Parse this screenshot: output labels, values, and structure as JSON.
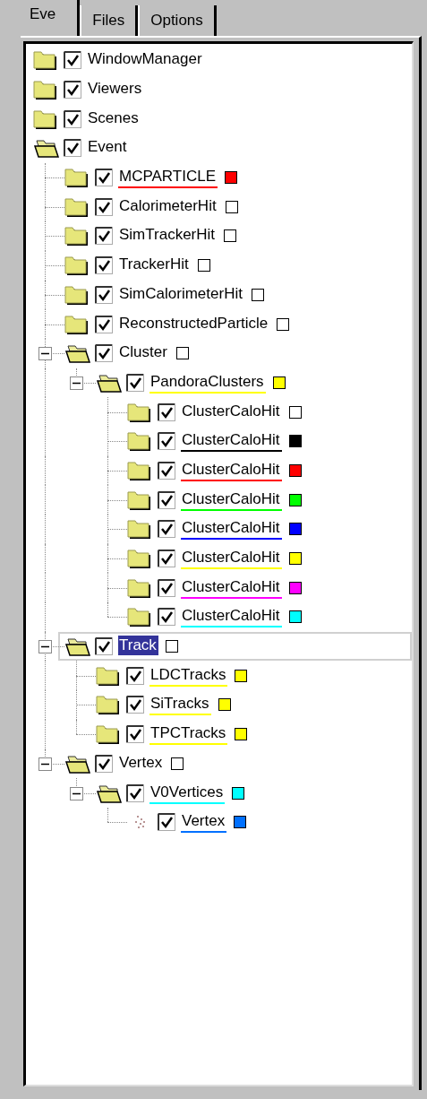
{
  "tabs": [
    {
      "label": "Eve",
      "selected": true
    },
    {
      "label": "Files",
      "selected": false
    },
    {
      "label": "Options",
      "selected": false
    }
  ],
  "tree": [
    {
      "label": "WindowManager",
      "kind": "folder",
      "checked": true,
      "selected": false
    },
    {
      "label": "Viewers",
      "kind": "folder",
      "checked": true,
      "selected": false
    },
    {
      "label": "Scenes",
      "kind": "folder",
      "checked": true,
      "selected": false
    },
    {
      "label": "Event",
      "kind": "folder",
      "checked": true,
      "selected": false,
      "expanded": true,
      "children": [
        {
          "label": "MCPARTICLE",
          "kind": "folder",
          "checked": true,
          "selected": false,
          "color": "#ff0000"
        },
        {
          "label": "CalorimeterHit",
          "kind": "folder",
          "checked": true,
          "selected": false,
          "color": "#ffffff"
        },
        {
          "label": "SimTrackerHit",
          "kind": "folder",
          "checked": true,
          "selected": false,
          "color": "#ffffff"
        },
        {
          "label": "TrackerHit",
          "kind": "folder",
          "checked": true,
          "selected": false,
          "color": "#ffffff"
        },
        {
          "label": "SimCalorimeterHit",
          "kind": "folder",
          "checked": true,
          "selected": false,
          "color": "#ffffff"
        },
        {
          "label": "ReconstructedParticle",
          "kind": "folder",
          "checked": true,
          "selected": false,
          "color": "#ffffff"
        },
        {
          "label": "Cluster",
          "kind": "folder",
          "checked": true,
          "selected": false,
          "color": "#ffffff",
          "expanded": true,
          "children": [
            {
              "label": "PandoraClusters",
              "kind": "folder",
              "checked": true,
              "selected": false,
              "color": "#ffff00",
              "expanded": true,
              "children": [
                {
                  "label": "ClusterCaloHit",
                  "kind": "folder",
                  "checked": true,
                  "selected": false,
                  "color": "#ffffff"
                },
                {
                  "label": "ClusterCaloHit",
                  "kind": "folder",
                  "checked": true,
                  "selected": false,
                  "color": "#000000"
                },
                {
                  "label": "ClusterCaloHit",
                  "kind": "folder",
                  "checked": true,
                  "selected": false,
                  "color": "#ff0000"
                },
                {
                  "label": "ClusterCaloHit",
                  "kind": "folder",
                  "checked": true,
                  "selected": false,
                  "color": "#00ff00"
                },
                {
                  "label": "ClusterCaloHit",
                  "kind": "folder",
                  "checked": true,
                  "selected": false,
                  "color": "#0000ff"
                },
                {
                  "label": "ClusterCaloHit",
                  "kind": "folder",
                  "checked": true,
                  "selected": false,
                  "color": "#ffff00"
                },
                {
                  "label": "ClusterCaloHit",
                  "kind": "folder",
                  "checked": true,
                  "selected": false,
                  "color": "#ff00ff"
                },
                {
                  "label": "ClusterCaloHit",
                  "kind": "folder",
                  "checked": true,
                  "selected": false,
                  "color": "#00ffff"
                }
              ]
            }
          ]
        },
        {
          "label": "Track",
          "kind": "folder",
          "checked": true,
          "selected": true,
          "color": "#ffffff",
          "expanded": true,
          "children": [
            {
              "label": "LDCTracks",
              "kind": "folder",
              "checked": true,
              "selected": false,
              "color": "#ffff00"
            },
            {
              "label": "SiTracks",
              "kind": "folder",
              "checked": true,
              "selected": false,
              "color": "#ffff00"
            },
            {
              "label": "TPCTracks",
              "kind": "folder",
              "checked": true,
              "selected": false,
              "color": "#ffff00"
            }
          ]
        },
        {
          "label": "Vertex",
          "kind": "folder",
          "checked": true,
          "selected": false,
          "color": "#ffffff",
          "expanded": true,
          "children": [
            {
              "label": "V0Vertices",
              "kind": "folder",
              "checked": true,
              "selected": false,
              "color": "#00ffff",
              "expanded": true,
              "children": [
                {
                  "label": "Vertex",
                  "kind": "point",
                  "checked": true,
                  "selected": false,
                  "color": "#0070ff"
                }
              ]
            }
          ]
        }
      ]
    }
  ]
}
